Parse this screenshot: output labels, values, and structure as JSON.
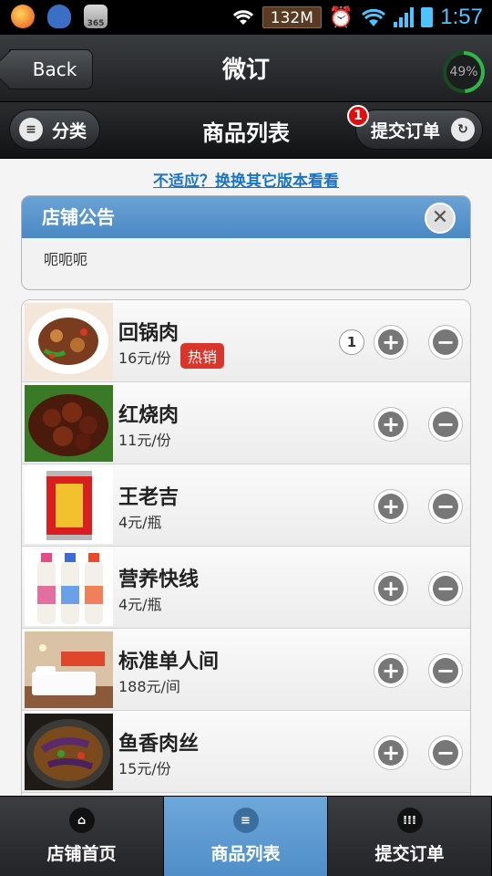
{
  "statusbar": {
    "memory": "132M",
    "time": "1:57"
  },
  "header": {
    "back_label": "Back",
    "title": "微订",
    "progress_value": 0.49,
    "progress_text": "49%"
  },
  "toolbar": {
    "category_label": "分类",
    "title": "商品列表",
    "submit_label": "提交订单",
    "submit_badge": "1"
  },
  "switch_link": "不适应？换换其它版本看看",
  "notice": {
    "title": "店铺公告",
    "body": "呃呃呃"
  },
  "products": [
    {
      "name": "回锅肉",
      "price": "16元/份",
      "tag": "热销",
      "qty": "1"
    },
    {
      "name": "红烧肉",
      "price": "11元/份"
    },
    {
      "name": "王老吉",
      "price": "4元/瓶"
    },
    {
      "name": "营养快线",
      "price": "4元/瓶"
    },
    {
      "name": "标准单人间",
      "price": "188元/间"
    },
    {
      "name": "鱼香肉丝",
      "price": "15元/份"
    }
  ],
  "tabs": [
    {
      "label": "店铺首页",
      "icon": "home-icon"
    },
    {
      "label": "商品列表",
      "icon": "list-icon",
      "active": true
    },
    {
      "label": "提交订单",
      "icon": "grid-icon"
    }
  ],
  "colors": {
    "accent": "#4f8ec8",
    "hot": "#d9362b",
    "badge": "#e30d0d",
    "link": "#1a74c4"
  }
}
